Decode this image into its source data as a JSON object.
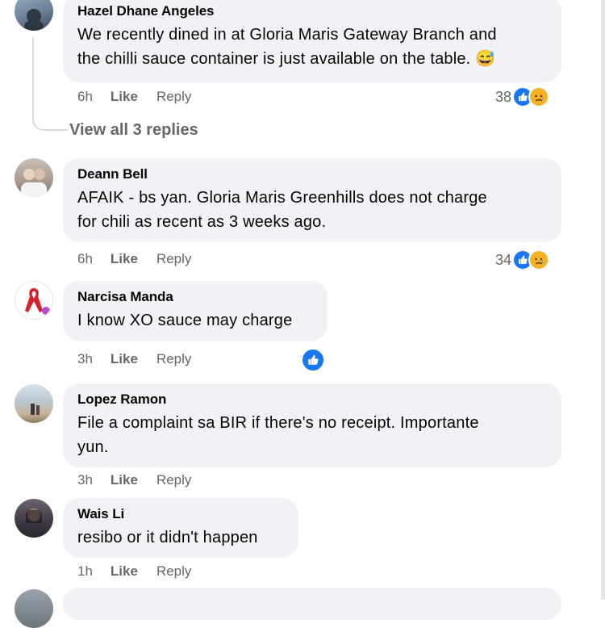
{
  "comments": [
    {
      "author": "Hazel Dhane Angeles",
      "text_lines": [
        "We recently dined in at Gloria Maris Gateway Branch and",
        "the chilli sauce container is just available on the table. 😅"
      ],
      "time": "6h",
      "like_label": "Like",
      "reply_label": "Reply",
      "reaction_count": "38",
      "reactions": [
        "like-icon",
        "sad-icon"
      ]
    },
    {
      "author": "Deann Bell",
      "text_lines": [
        "AFAIK - bs yan. Gloria Maris Greenhills does not charge",
        "for chili as recent as 3 weeks ago."
      ],
      "time": "6h",
      "like_label": "Like",
      "reply_label": "Reply",
      "reaction_count": "34",
      "reactions": [
        "like-icon",
        "sad-icon"
      ]
    },
    {
      "author": "Narcisa Manda",
      "text_lines": [
        "I know XO sauce may charge"
      ],
      "time": "3h",
      "like_label": "Like",
      "reply_label": "Reply",
      "reaction_count": "",
      "reactions": [
        "like-icon"
      ]
    },
    {
      "author": "Lopez Ramon",
      "text_lines": [
        "File a complaint sa BIR if there's no receipt. Importante",
        "yun."
      ],
      "time": "3h",
      "like_label": "Like",
      "reply_label": "Reply"
    },
    {
      "author": "Wais Li",
      "text_lines": [
        "resibo or it didn't happen"
      ],
      "time": "1h",
      "like_label": "Like",
      "reply_label": "Reply"
    }
  ],
  "view_replies_label": "View all 3 replies",
  "colors": {
    "bubble": "#f0f2f5",
    "secondary_text": "#65676b",
    "like_blue": "#1877f2",
    "sad_yellow": "#f7b125"
  }
}
